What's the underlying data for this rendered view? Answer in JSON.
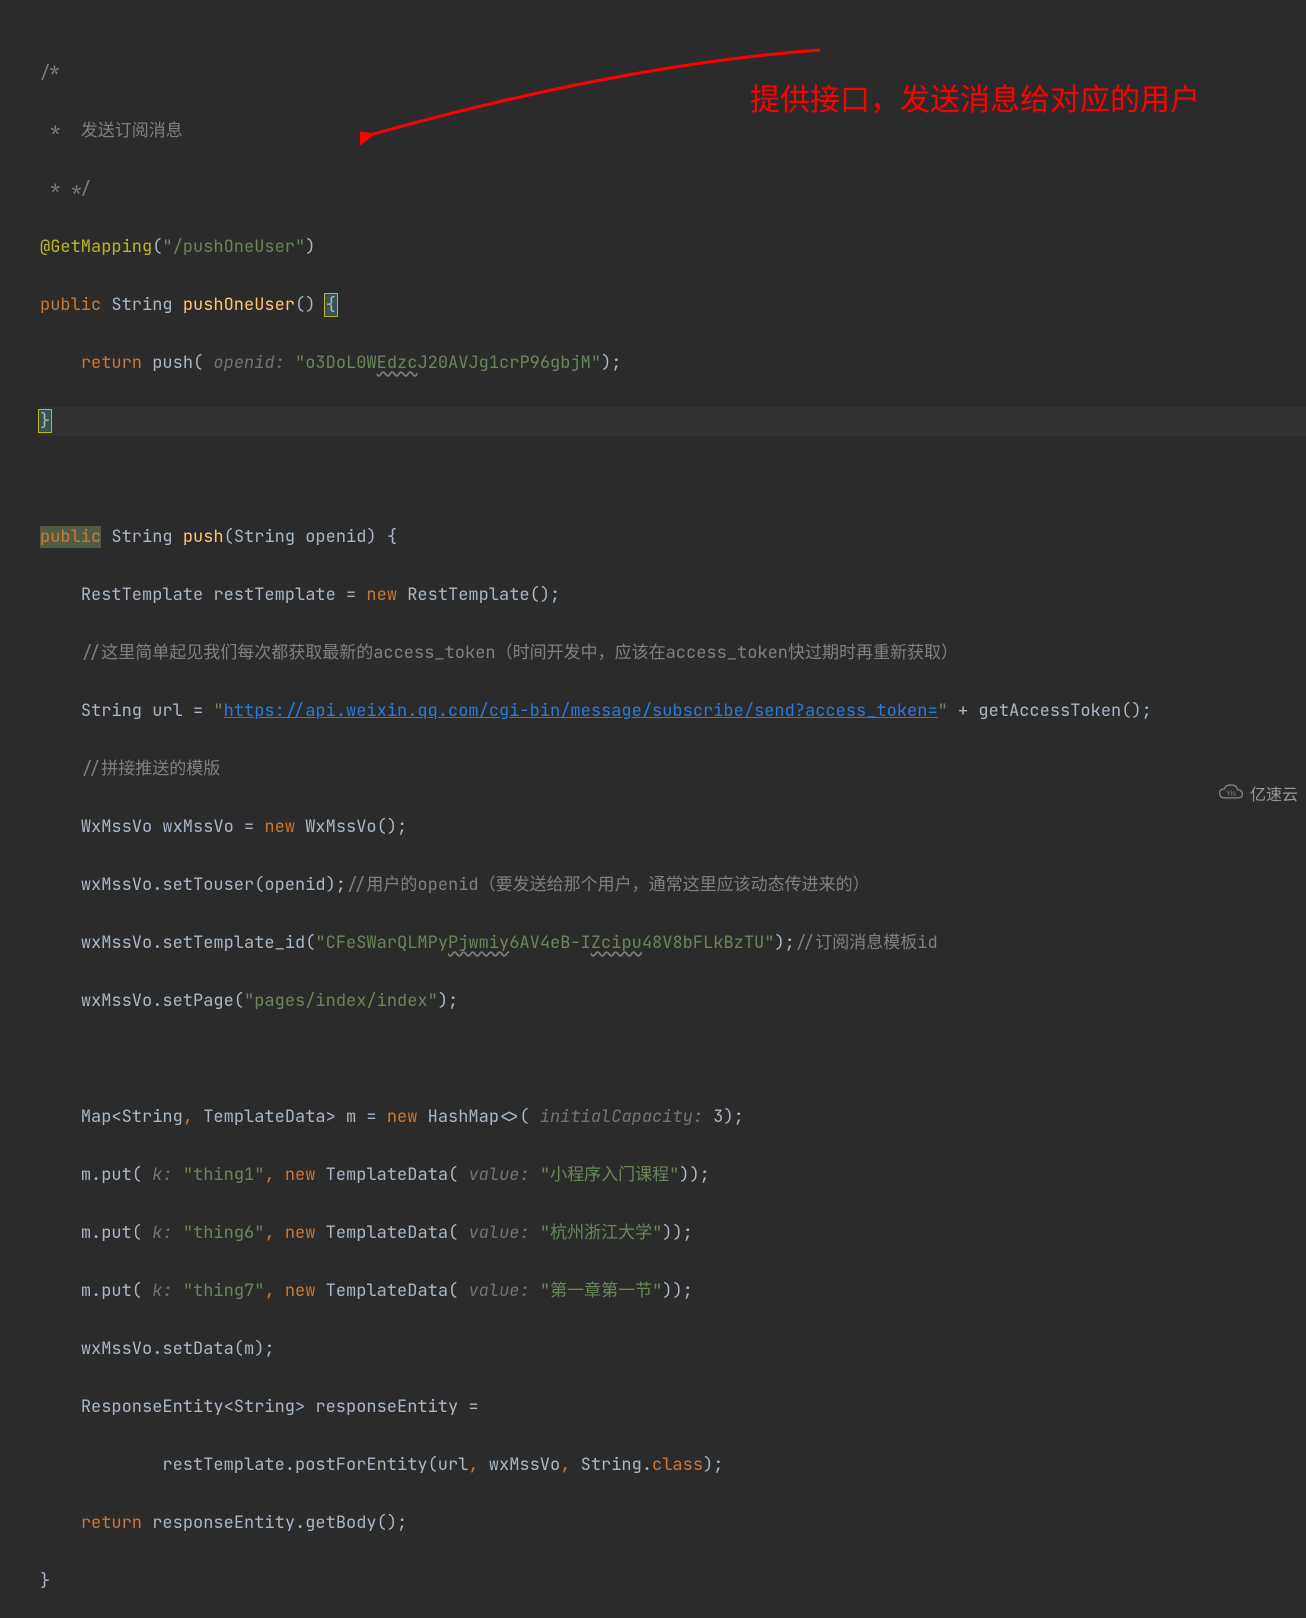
{
  "annotation_text": "提供接口，发送消息给对应的用户",
  "watermark": "亿速云",
  "code": {
    "c01": "/*",
    "c02": " *  发送订阅消息",
    "c03": " * */",
    "c04a": "@GetMapping",
    "c04b": "(",
    "c04c": "\"/pushOneUser\"",
    "c04d": ")",
    "c05a": "public",
    "c05b": " String ",
    "c05c": "pushOneUser",
    "c05d": "() ",
    "c05e": "{",
    "c06a": "return",
    "c06b": " push(",
    "c06c": " openid: ",
    "c06d": "\"o3DoL0W",
    "c06e": "Edzc",
    "c06f": "J20AVJg1crP96gbjM\"",
    "c06g": ");",
    "c07a": "}",
    "c08a": "public",
    "c08b": " String ",
    "c08c": "push",
    "c08d": "(String openid) {",
    "c09a": "RestTemplate restTemplate = ",
    "c09b": "new",
    "c09c": " RestTemplate();",
    "c10a": "//这里简单起见我们每次都获取最新的access_token（时间开发中，应该在access_token快过期时再重新获取）",
    "c11a": "String url = ",
    "c11b": "\"",
    "c11c": "https://api.weixin.qq.com/cgi-bin/message/subscribe/send?access_token=",
    "c11d": "\"",
    "c11e": " + getAccessToken();",
    "c12a": "//拼接推送的模版",
    "c13a": "WxMssVo wxMssVo = ",
    "c13b": "new",
    "c13c": " WxMssVo();",
    "c14a": "wxMssVo.setTouser(openid);",
    "c14b": "//用户的openid（要发送给那个用户，通常这里应该动态传进来的）",
    "c15a": "wxMssVo.setTemplate_id(",
    "c15b": "\"CFeSWarQLMPy",
    "c15c": "Pjwmiy",
    "c15d": "6AV4eB-I",
    "c15e": "Zcipu",
    "c15f": "48V8bFLkBzTU\"",
    "c15g": ");",
    "c15h": "//订阅消息模板id",
    "c16a": "wxMssVo.setPage(",
    "c16b": "\"pages/index/index\"",
    "c16c": ");",
    "c17a": "Map<String",
    "c17b": ",",
    "c17c": " TemplateData> m = ",
    "c17d": "new",
    "c17e": " HashMap<>(",
    "c17f": " initialCapacity: ",
    "c17g": "3",
    "c17h": ");",
    "c18a": "m.put(",
    "c18b": " k: ",
    "c18c": "\"thing1\"",
    "c18d": ", ",
    "c18e": "new",
    "c18f": " TemplateData(",
    "c18g": " value: ",
    "c18h": "\"小程序入门课程\"",
    "c18i": "));",
    "c19a": "m.put(",
    "c19b": " k: ",
    "c19c": "\"thing6\"",
    "c19d": ", ",
    "c19e": "new",
    "c19f": " TemplateData(",
    "c19g": " value: ",
    "c19h": "\"杭州浙江大学\"",
    "c19i": "));",
    "c20a": "m.put(",
    "c20b": " k: ",
    "c20c": "\"thing7\"",
    "c20d": ", ",
    "c20e": "new",
    "c20f": " TemplateData(",
    "c20g": " value: ",
    "c20h": "\"第一章第一节\"",
    "c20i": "));",
    "c21a": "wxMssVo.setData(m);",
    "c22a": "ResponseEntity<String> responseEntity =",
    "c23a": "restTemplate.postForEntity(url",
    "c23b": ",",
    "c23c": " wxMssVo",
    "c23d": ",",
    "c23e": " String.",
    "c23f": "class",
    "c23g": ");",
    "c24a": "return",
    "c24b": " responseEntity.getBody();",
    "c25a": "}"
  }
}
